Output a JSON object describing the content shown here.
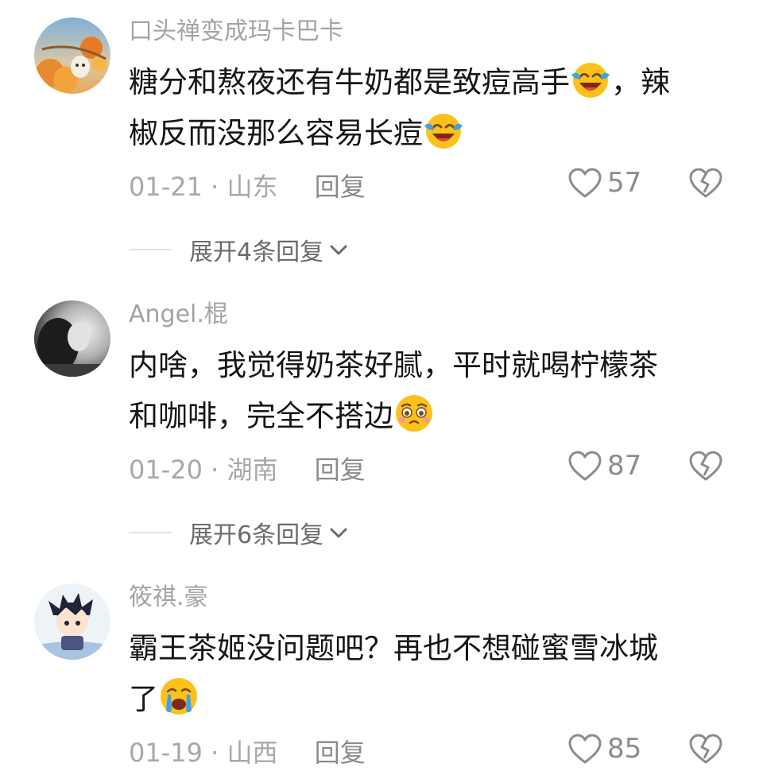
{
  "comments": [
    {
      "username": "口头禅变成玛卡巴卡",
      "text_line1": "糖分和熬夜还有牛奶都是致痘高手",
      "text_after_emoji1": "，辣",
      "text_line2": "椒反而没那么容易长痘",
      "date": "01-21",
      "separator": "·",
      "location": "山东",
      "reply_label": "回复",
      "likes": "57",
      "expand_label": "展开4条回复",
      "emoji": "laughing-crying"
    },
    {
      "username": "Angel.棍",
      "text_line1": "内啥，我觉得奶茶好腻，平时就喝柠檬茶",
      "text_line2": "和咖啡，完全不搭边",
      "date": "01-20",
      "separator": "·",
      "location": "湖南",
      "reply_label": "回复",
      "likes": "87",
      "expand_label": "展开6条回复",
      "emoji": "pleading-face"
    },
    {
      "username": "筱祺.豪",
      "text_line1": "霸王茶姬没问题吧？再也不想碰蜜雪冰城",
      "text_line2": "了",
      "date": "01-19",
      "separator": "·",
      "location": "山西",
      "reply_label": "回复",
      "likes": "85",
      "emoji": "crying-face"
    }
  ],
  "icons": {
    "like": "heart-outline-icon",
    "dislike": "broken-heart-icon",
    "expand": "chevron-down-icon"
  },
  "colors": {
    "username": "#a3a3a3",
    "text": "#161616",
    "meta": "#a8a8a8",
    "emoji_yellow": "#fcc21b"
  }
}
